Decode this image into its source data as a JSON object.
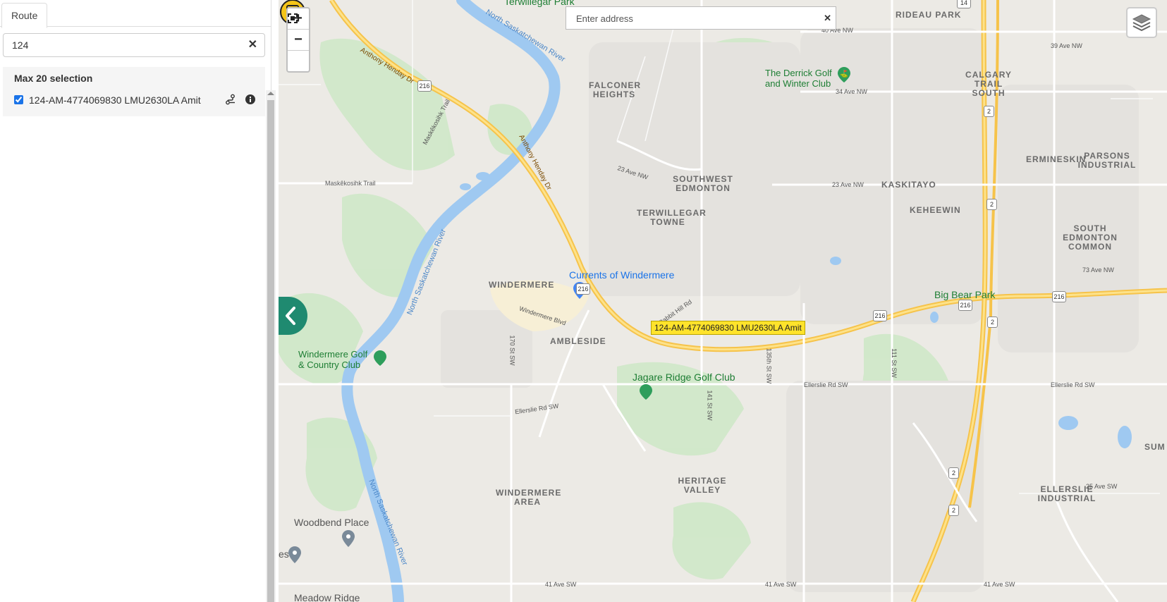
{
  "panel": {
    "tab_label": "Route",
    "search_value": "124",
    "group_title": "Max 20 selection",
    "items": [
      {
        "label": "124-AM-4774069830 LMU2630LA Amit",
        "checked": true
      }
    ]
  },
  "map": {
    "address_placeholder": "Enter address",
    "zoom_in": "+",
    "zoom_out": "−",
    "vehicle_label": "124-AM-4774069830 LMU2630LA Amit",
    "areas": {
      "terwillegar_park": "Terwillegar Park",
      "rideau_park": "RIDEAU PARK",
      "calgary_trail_south": "CALGARY TRAIL SOUTH",
      "falconer_heights": "FALCONER HEIGHTS",
      "southwest_edmonton": "SOUTHWEST EDMONTON",
      "kaskitayo": "KASKITAYO",
      "ermineskin": "ERMINESKIN",
      "parsons_industrial": "PARSONS INDUSTRIAL",
      "terwillegar_towne": "TERWILLEGAR TOWNE",
      "keheewin": "KEHEEWIN",
      "south_edmonton_common": "SOUTH EDMONTON COMMON",
      "windermere": "WINDERMERE",
      "ambleside": "AMBLESIDE",
      "heritage_valley": "HERITAGE VALLEY",
      "windermere_area": "WINDERMERE AREA",
      "ellerslie_industrial": "ELLERSLIE INDUSTRIAL",
      "sum": "SUM"
    },
    "pois": {
      "derrick": "The Derrick Golf and Winter Club",
      "currents": "Currents of Windermere",
      "big_bear": "Big Bear Park",
      "windermere_golf": "Windermere Golf & Country Club",
      "jagare": "Jagare Ridge Golf Club",
      "woodbend": "Woodbend Place",
      "meadow_ridge": "Meadow Ridge",
      "es": "es"
    },
    "roads": {
      "anthony_henday_1": "Anthony Henday Dr",
      "anthony_henday_2": "Anthony Henday Dr",
      "maskekosihk_trail": "Maskêkosihk Trail",
      "maskekosihk_trail_2": "Maskêkosihk Trail",
      "ellerslie_rd_1": "Ellerslie Rd SW",
      "ellerslie_rd_2": "Ellerslie Rd SW",
      "ellerslie_rd_3": "Ellerslie Rd SW",
      "ave41_1": "41 Ave SW",
      "ave41_2": "41 Ave SW",
      "ave41_3": "41 Ave SW",
      "ave23_1": "23 Ave NW",
      "ave23_2": "23 Ave NW",
      "ave34": "34 Ave NW",
      "ave39": "39 Ave NW",
      "ave40": "40 Ave NW",
      "ave25": "25 Ave SW",
      "ave73": "73 Ave NW",
      "windermere_blvd": "Windermere Blvd",
      "rabbit_hill": "Rabbit Hill Rd",
      "st170": "170 St SW",
      "st135": "135th St SW",
      "st111": "111 St SW",
      "st141": "141 St SW"
    },
    "shields": {
      "s216": "216",
      "s2": "2",
      "s14": "14"
    },
    "rivers": {
      "north_sask": "North Saskatchewan River"
    }
  }
}
